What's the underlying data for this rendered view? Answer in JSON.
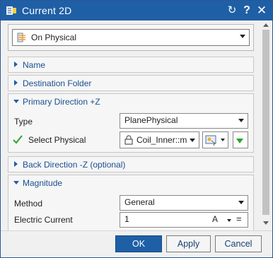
{
  "window": {
    "title": "Current 2D"
  },
  "titlebar": {
    "reset_glyph": "↻",
    "help_glyph": "?",
    "close_glyph": "✕"
  },
  "top": {
    "type_value": "On Physical",
    "icon": "current-2d-type-icon"
  },
  "groups": {
    "name": {
      "label": "Name"
    },
    "destination": {
      "label": "Destination Folder"
    },
    "primary": {
      "label": "Primary Direction +Z",
      "type_label": "Type",
      "type_value": "PlanePhysical",
      "select_label": "Select Physical",
      "select_value": "Coil_Inner::m"
    },
    "back": {
      "label": "Back Direction -Z (optional)"
    },
    "magnitude": {
      "label": "Magnitude",
      "method_label": "Method",
      "method_value": "General",
      "current_label": "Electric Current",
      "current_value": "1",
      "current_unit": "A",
      "equals_glyph": "="
    }
  },
  "buttons": {
    "ok": "OK",
    "apply": "Apply",
    "cancel": "Cancel"
  },
  "colors": {
    "titlebar": "#1f5fa6",
    "accent": "#1f5fa6",
    "check": "#2aa52a"
  }
}
